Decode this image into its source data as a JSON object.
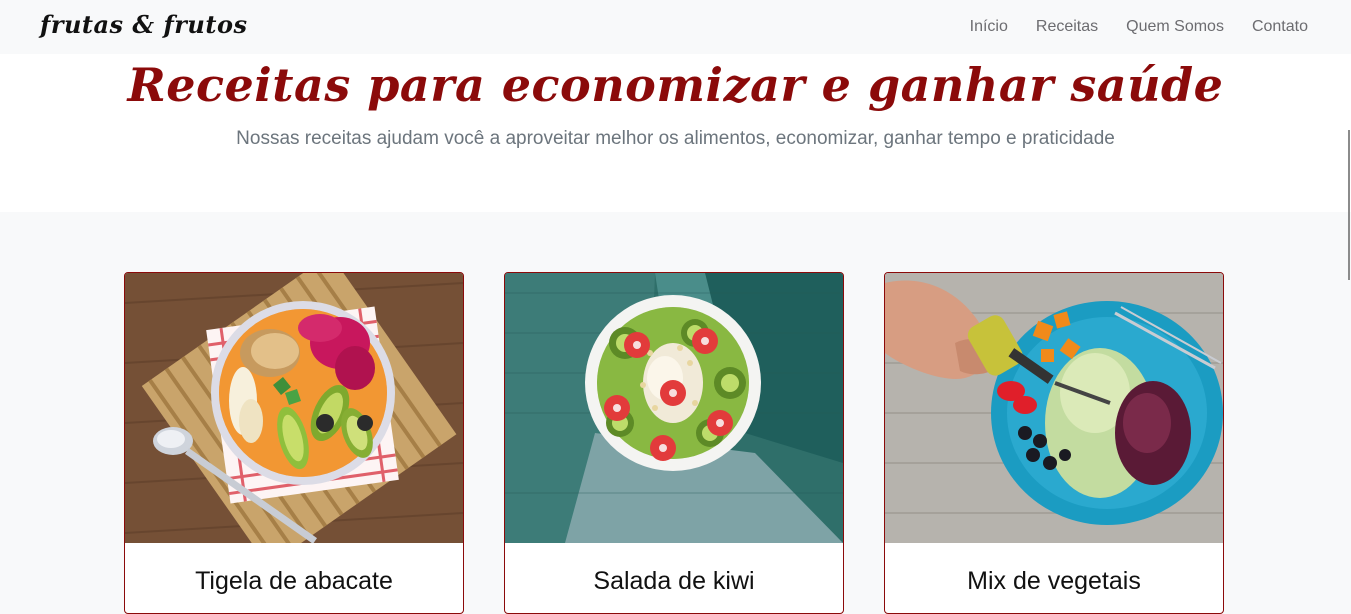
{
  "navbar": {
    "brand": "frutas & frutos",
    "links": [
      "Início",
      "Receitas",
      "Quem Somos",
      "Contato"
    ]
  },
  "hero": {
    "title": "Receitas para economizar e ganhar saúde",
    "subtitle": "Nossas receitas ajudam você a aproveitar melhor os alimentos, economizar, ganhar tempo e praticidade"
  },
  "cards": [
    {
      "title": "Tigela de abacate"
    },
    {
      "title": "Salada de kiwi"
    },
    {
      "title": "Mix de vegetais"
    }
  ],
  "colors": {
    "accent": "#8b0a0a",
    "navbar_bg": "#f8f9fa",
    "muted_text": "#6c757d"
  }
}
